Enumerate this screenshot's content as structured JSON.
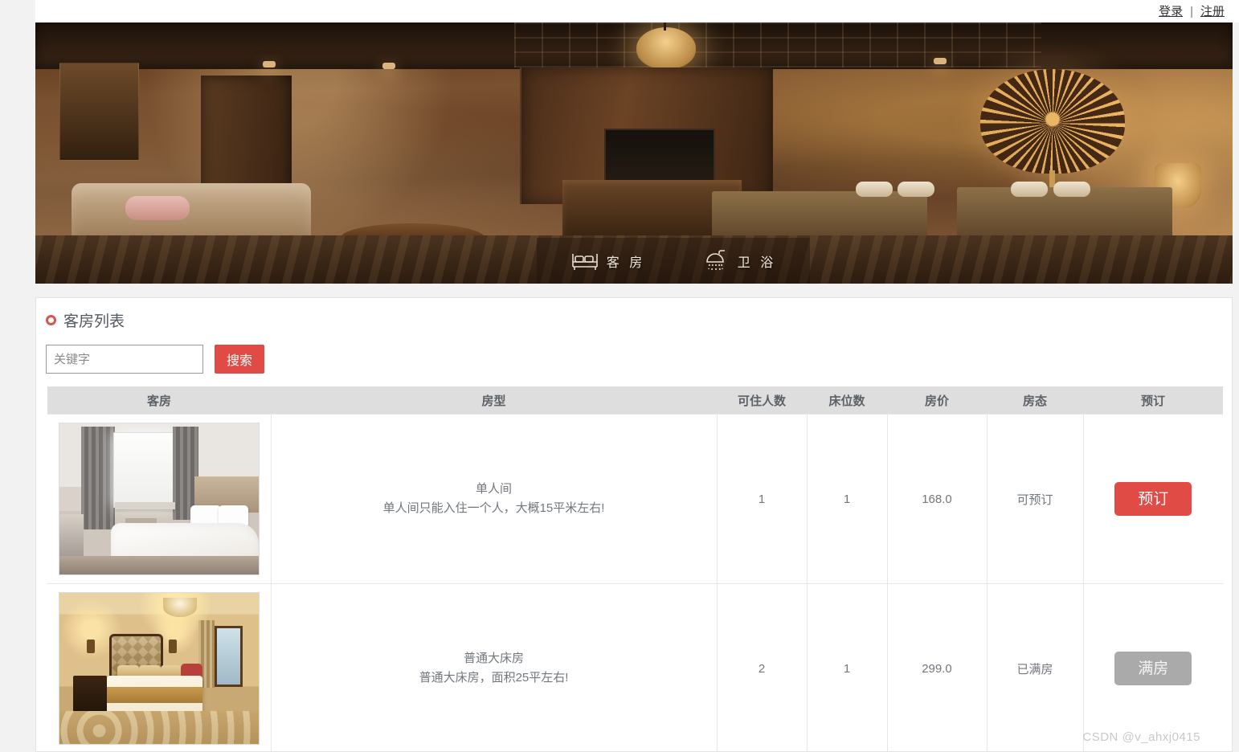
{
  "topbar": {
    "login": "登录",
    "separator": "|",
    "register": "注册"
  },
  "banner": {
    "categories": [
      {
        "icon": "bed-icon",
        "label": "客 房"
      },
      {
        "icon": "shower-icon",
        "label": "卫 浴"
      }
    ]
  },
  "panel": {
    "title": "客房列表",
    "search": {
      "placeholder": "关键字",
      "value": "",
      "button_label": "搜索"
    },
    "table": {
      "headers": [
        "客房",
        "房型",
        "可住人数",
        "床位数",
        "房价",
        "房态",
        "预订"
      ],
      "rows": [
        {
          "image_alt": "单人间客房图片",
          "type_name": "单人间",
          "type_desc": "单人间只能入住一个人，大概15平米左右!",
          "capacity": "1",
          "beds": "1",
          "price": "168.0",
          "status": "可预订",
          "action_label": "预订",
          "action_enabled": true
        },
        {
          "image_alt": "普通大床房客房图片",
          "type_name": "普通大床房",
          "type_desc": "普通大床房，面积25平左右!",
          "capacity": "2",
          "beds": "1",
          "price": "299.0",
          "status": "已满房",
          "action_label": "满房",
          "action_enabled": false
        }
      ]
    }
  },
  "watermark": "CSDN @v_ahxj0415",
  "colors": {
    "accent_red": "#e04b45",
    "disabled_gray": "#aaaaaa",
    "table_header_bg": "#dedede"
  }
}
